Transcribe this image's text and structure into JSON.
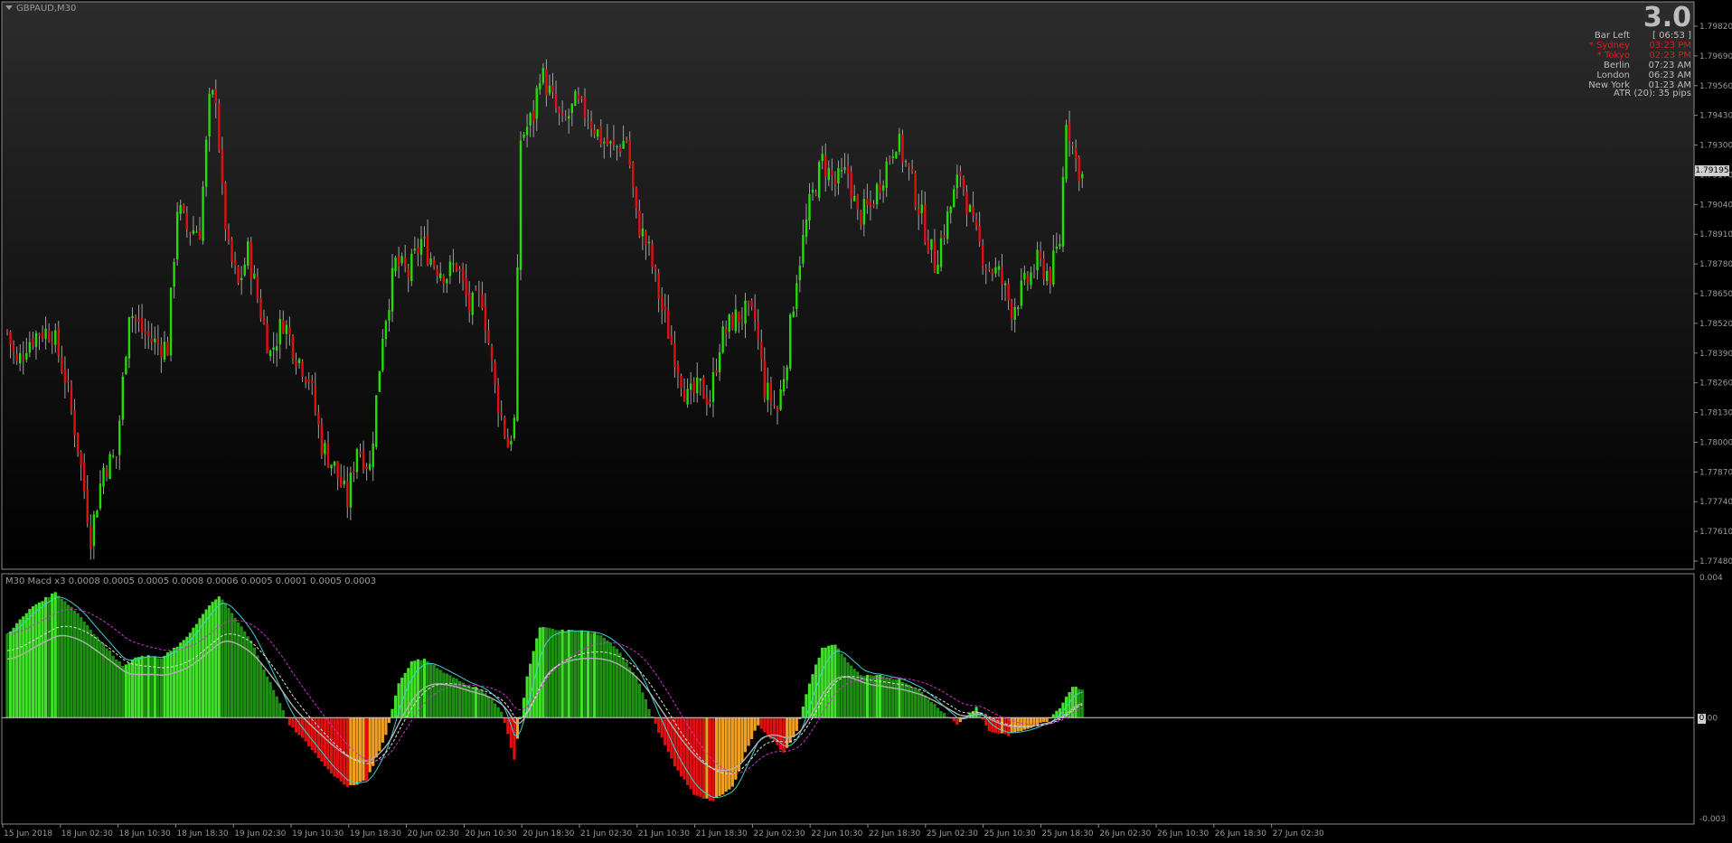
{
  "window": {
    "symbol_label": "GBPAUD,M30"
  },
  "info_panel": {
    "big_number": "3.0",
    "rows": [
      {
        "label": "Bar Left",
        "value": "[ 06:53 ]",
        "color": "#bdbdbd"
      },
      {
        "label": "* Sydney",
        "value": "03:23 PM",
        "color": "#e81818"
      },
      {
        "label": "* Tokyo",
        "value": "02:23 PM",
        "color": "#e81818"
      },
      {
        "label": "Berlin",
        "value": "07:23 AM",
        "color": "#bdbdbd"
      },
      {
        "label": "London",
        "value": "06:23 AM",
        "color": "#bdbdbd"
      },
      {
        "label": "New York",
        "value": "01:23 AM",
        "color": "#bdbdbd"
      }
    ],
    "atr": "ATR (20): 35 pips"
  },
  "price_axis": {
    "labels": [
      "1.79820",
      "1.79690",
      "1.79560",
      "1.79430",
      "1.79300",
      "1.79170",
      "1.79040",
      "1.78910",
      "1.78780",
      "1.78650",
      "1.78520",
      "1.78390",
      "1.78260",
      "1.78130",
      "1.78000",
      "1.77870",
      "1.77740",
      "1.77610",
      "1.77480"
    ],
    "current_price": "1.79195"
  },
  "macd_panel": {
    "label": "M30 Macd x3 0.0008 0.0005 0.0005 0.0008 0.0006 0.0005 0.0001 0.0005 0.0003",
    "axis_labels": {
      "top": "0.004",
      "zero": "0.00",
      "bottom": "-0.003"
    },
    "zero_marker": "0"
  },
  "time_axis": {
    "labels": [
      "15 Jun 2018",
      "18 Jun 02:30",
      "18 Jun 10:30",
      "18 Jun 18:30",
      "19 Jun 02:30",
      "19 Jun 10:30",
      "19 Jun 18:30",
      "20 Jun 02:30",
      "20 Jun 10:30",
      "20 Jun 18:30",
      "21 Jun 02:30",
      "21 Jun 10:30",
      "21 Jun 18:30",
      "22 Jun 02:30",
      "22 Jun 10:30",
      "22 Jun 18:30",
      "25 Jun 02:30",
      "25 Jun 10:30",
      "25 Jun 18:30",
      "26 Jun 02:30",
      "26 Jun 10:30",
      "26 Jun 18:30",
      "27 Jun 02:30"
    ]
  },
  "colors": {
    "bull": "#22dd00",
    "bear": "#e01010",
    "wick": "#a0a0a0",
    "macd_pos_dark": "#1f8f14",
    "macd_pos_light": "#42e02a",
    "macd_neg_orange": "#f0a020",
    "macd_neg_red": "#e01010",
    "signal_cyan": "#40d0d0",
    "signal_white": "#e0e0e0",
    "signal_magenta": "#d030d0"
  },
  "chart_data": {
    "type": "candlestick",
    "symbol": "GBPAUD",
    "timeframe": "M30",
    "price_range": [
      1.7748,
      1.7988
    ],
    "anchor_closes": [
      [
        0,
        1.785
      ],
      [
        3,
        1.7835
      ],
      [
        6,
        1.7845
      ],
      [
        10,
        1.785
      ],
      [
        14,
        1.785
      ],
      [
        18,
        1.783
      ],
      [
        22,
        1.78
      ],
      [
        26,
        1.776
      ],
      [
        30,
        1.779
      ],
      [
        34,
        1.7795
      ],
      [
        38,
        1.786
      ],
      [
        42,
        1.785
      ],
      [
        46,
        1.7845
      ],
      [
        50,
        1.7843
      ],
      [
        53,
        1.7905
      ],
      [
        56,
        1.7895
      ],
      [
        60,
        1.7895
      ],
      [
        63,
        1.795
      ],
      [
        65,
        1.7955
      ],
      [
        67,
        1.791
      ],
      [
        69,
        1.7885
      ],
      [
        72,
        1.787
      ],
      [
        75,
        1.7885
      ],
      [
        78,
        1.7865
      ],
      [
        82,
        1.784
      ],
      [
        86,
        1.7855
      ],
      [
        90,
        1.784
      ],
      [
        94,
        1.783
      ],
      [
        98,
        1.78
      ],
      [
        102,
        1.779
      ],
      [
        106,
        1.7775
      ],
      [
        109,
        1.78
      ],
      [
        113,
        1.779
      ],
      [
        117,
        1.785
      ],
      [
        121,
        1.788
      ],
      [
        125,
        1.7875
      ],
      [
        129,
        1.789
      ],
      [
        133,
        1.788
      ],
      [
        137,
        1.7875
      ],
      [
        140,
        1.788
      ],
      [
        144,
        1.786
      ],
      [
        148,
        1.7865
      ],
      [
        152,
        1.7825
      ],
      [
        156,
        1.78
      ],
      [
        158,
        1.781
      ],
      [
        160,
        1.7935
      ],
      [
        164,
        1.7945
      ],
      [
        166,
        1.7965
      ],
      [
        169,
        1.7955
      ],
      [
        173,
        1.794
      ],
      [
        177,
        1.795
      ],
      [
        181,
        1.7945
      ],
      [
        185,
        1.7935
      ],
      [
        189,
        1.793
      ],
      [
        193,
        1.7935
      ],
      [
        196,
        1.79
      ],
      [
        200,
        1.7885
      ],
      [
        204,
        1.786
      ],
      [
        208,
        1.784
      ],
      [
        212,
        1.782
      ],
      [
        216,
        1.7825
      ],
      [
        219,
        1.782
      ],
      [
        222,
        1.7845
      ],
      [
        226,
        1.7855
      ],
      [
        230,
        1.7858
      ],
      [
        233,
        1.7855
      ],
      [
        236,
        1.7825
      ],
      [
        240,
        1.7815
      ],
      [
        243,
        1.784
      ],
      [
        246,
        1.7875
      ],
      [
        250,
        1.7905
      ],
      [
        254,
        1.7925
      ],
      [
        258,
        1.7915
      ],
      [
        262,
        1.792
      ],
      [
        265,
        1.79
      ],
      [
        269,
        1.7905
      ],
      [
        273,
        1.792
      ],
      [
        277,
        1.7935
      ],
      [
        281,
        1.792
      ],
      [
        285,
        1.79
      ],
      [
        289,
        1.788
      ],
      [
        293,
        1.79
      ],
      [
        297,
        1.792
      ],
      [
        301,
        1.7895
      ],
      [
        305,
        1.788
      ],
      [
        309,
        1.7875
      ],
      [
        313,
        1.786
      ],
      [
        317,
        1.787
      ],
      [
        321,
        1.788
      ],
      [
        325,
        1.7875
      ],
      [
        328,
        1.789
      ],
      [
        330,
        1.7945
      ],
      [
        333,
        1.7925
      ],
      [
        335,
        1.7918
      ]
    ],
    "macd_anchors": [
      [
        0,
        0.0024
      ],
      [
        8,
        0.0032
      ],
      [
        15,
        0.0036
      ],
      [
        22,
        0.003
      ],
      [
        29,
        0.0022
      ],
      [
        36,
        0.0015
      ],
      [
        42,
        0.0018
      ],
      [
        48,
        0.0017
      ],
      [
        55,
        0.0022
      ],
      [
        62,
        0.0031
      ],
      [
        66,
        0.0035
      ],
      [
        70,
        0.003
      ],
      [
        76,
        0.0022
      ],
      [
        82,
        0.001
      ],
      [
        88,
        -0.0002
      ],
      [
        94,
        -0.0008
      ],
      [
        100,
        -0.0015
      ],
      [
        106,
        -0.002
      ],
      [
        112,
        -0.0018
      ],
      [
        118,
        -0.0005
      ],
      [
        122,
        0.001
      ],
      [
        126,
        0.0016
      ],
      [
        130,
        0.0017
      ],
      [
        136,
        0.0013
      ],
      [
        142,
        0.001
      ],
      [
        148,
        0.0008
      ],
      [
        154,
        0.0002
      ],
      [
        158,
        -0.0012
      ],
      [
        162,
        0.0012
      ],
      [
        166,
        0.0026
      ],
      [
        172,
        0.0025
      ],
      [
        178,
        0.0025
      ],
      [
        184,
        0.0024
      ],
      [
        190,
        0.002
      ],
      [
        196,
        0.0012
      ],
      [
        202,
        -0.0002
      ],
      [
        208,
        -0.0014
      ],
      [
        214,
        -0.0022
      ],
      [
        220,
        -0.0024
      ],
      [
        226,
        -0.002
      ],
      [
        230,
        -0.001
      ],
      [
        234,
        -0.0002
      ],
      [
        238,
        -0.0006
      ],
      [
        242,
        -0.001
      ],
      [
        246,
        -0.0004
      ],
      [
        250,
        0.001
      ],
      [
        254,
        0.002
      ],
      [
        258,
        0.0021
      ],
      [
        262,
        0.0016
      ],
      [
        266,
        0.0012
      ],
      [
        272,
        0.0012
      ],
      [
        278,
        0.0011
      ],
      [
        284,
        0.0008
      ],
      [
        290,
        0.0003
      ],
      [
        296,
        -0.0002
      ],
      [
        302,
        0.0003
      ],
      [
        306,
        -0.0004
      ],
      [
        312,
        -0.0005
      ],
      [
        318,
        -0.0003
      ],
      [
        324,
        -0.0001
      ],
      [
        328,
        0.0003
      ],
      [
        332,
        0.0009
      ],
      [
        336,
        0.0008
      ]
    ],
    "macd_range": [
      -0.003,
      0.004
    ]
  }
}
